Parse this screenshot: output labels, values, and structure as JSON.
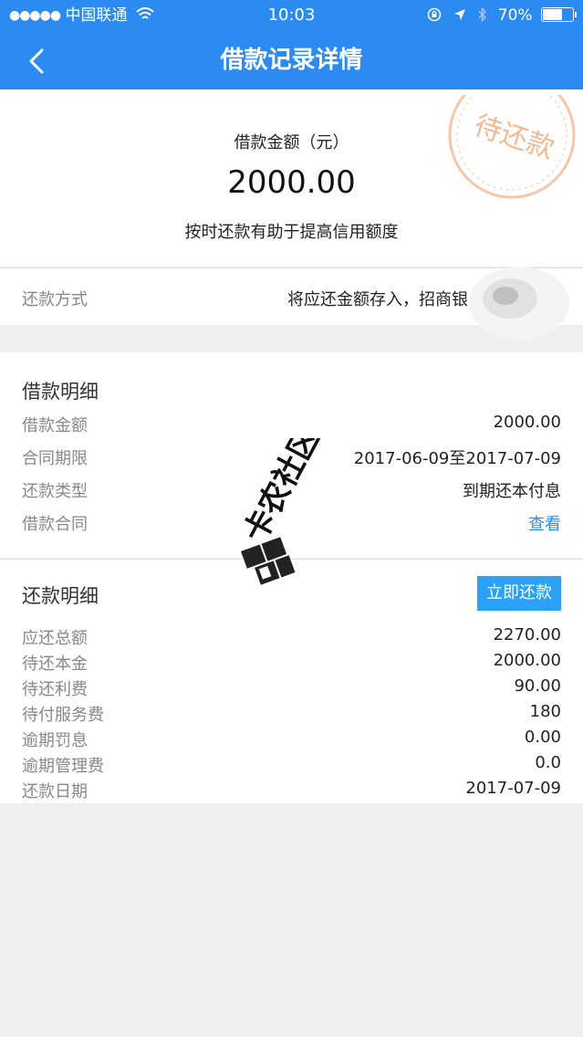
{
  "status_bar": {
    "carrier": "中国联通",
    "time": "10:03",
    "battery": "70%",
    "battery_level": 0.7,
    "icons": [
      "signal-dots-icon",
      "wifi-icon",
      "orientation-lock-icon",
      "location-icon",
      "bluetooth-icon",
      "battery-icon"
    ]
  },
  "nav": {
    "title": "借款记录详情",
    "back_icon": "chevron-left-icon"
  },
  "summary": {
    "amount_label": "借款金额（元）",
    "amount": "2000.00",
    "tip": "按时还款有助于提高信用额度",
    "stamp_text": "待还款"
  },
  "repay_method": {
    "label": "还款方式",
    "value": "将应还金额存入，招商银"
  },
  "loan_detail": {
    "title": "借款明细",
    "rows": [
      {
        "label": "借款金额",
        "value": "2000.00"
      },
      {
        "label": "合同期限",
        "value": "2017-06-09至2017-07-09"
      },
      {
        "label": "还款类型",
        "value": "到期还本付息"
      },
      {
        "label": "借款合同",
        "value": "查看"
      }
    ]
  },
  "repay_detail": {
    "title": "还款明细",
    "pay_button": "立即还款",
    "rows": [
      {
        "label": "应还总额",
        "value": "2270.00"
      },
      {
        "label": "待还本金",
        "value": "2000.00"
      },
      {
        "label": "待还利费",
        "value": "90.00"
      },
      {
        "label": "待付服务费",
        "value": "180"
      },
      {
        "label": "逾期罚息",
        "value": "0.00"
      },
      {
        "label": "逾期管理费",
        "value": "0.0"
      },
      {
        "label": "还款日期",
        "value": "2017-07-09"
      }
    ]
  },
  "watermark": {
    "text": "卡农社区"
  },
  "colors": {
    "header": "#2b8bf1",
    "button": "#2aa2f7",
    "link": "#2b8bf1",
    "stamp": "#f0a070"
  }
}
